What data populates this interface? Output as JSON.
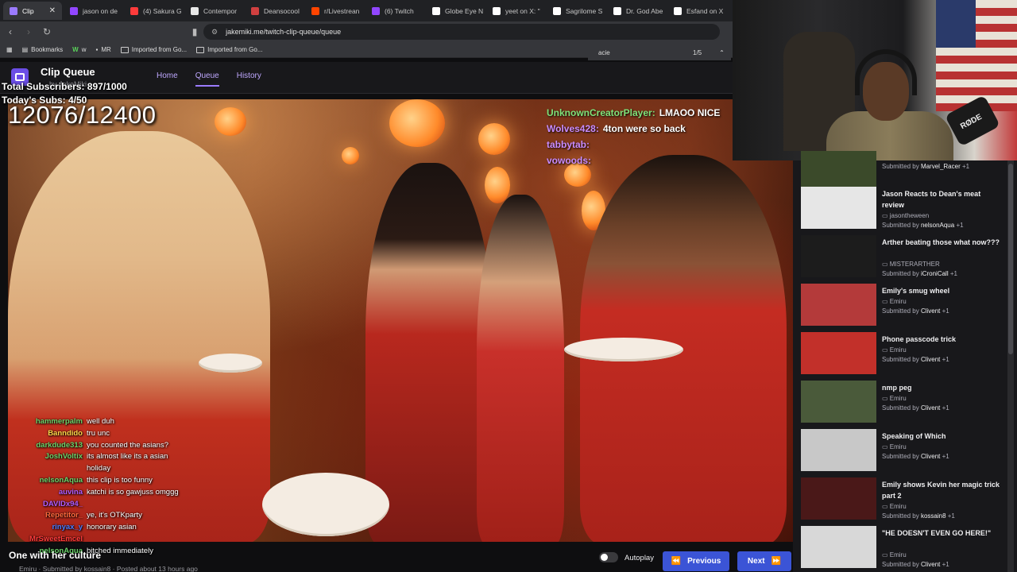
{
  "browser": {
    "tabs": [
      {
        "label": "Clip",
        "color": "#9b7bff",
        "active": true
      },
      {
        "label": "jason on de",
        "color": "#9146ff"
      },
      {
        "label": "(4) Sakura G",
        "color": "#ff3b3b"
      },
      {
        "label": "Contempor",
        "color": "#e8e8e8"
      },
      {
        "label": "Deansocool",
        "color": "#d04040"
      },
      {
        "label": "r/Livestrean",
        "color": "#ff4500"
      },
      {
        "label": "(6) Twitch",
        "color": "#9146ff"
      },
      {
        "label": "Globe Eye N",
        "color": "#ffffff"
      },
      {
        "label": "yeet on X: \"",
        "color": "#ffffff"
      },
      {
        "label": "Sagrilome S",
        "color": "#ffffff"
      },
      {
        "label": "Dr. God Abe",
        "color": "#ffffff"
      },
      {
        "label": "Esfand on X",
        "color": "#ffffff"
      }
    ],
    "tab_close": "✕",
    "url": "jakemiki.me/twitch-clip-queue/queue",
    "bookmarks": [
      "Bookmarks",
      "w",
      "MR",
      "Imported from Go...",
      "Imported from Go..."
    ],
    "find": {
      "query": "acie",
      "count": "1/5"
    }
  },
  "app": {
    "title": "Clip Queue",
    "subtitle": "by JakeMiki",
    "nav": [
      "Home",
      "Queue",
      "History"
    ]
  },
  "overlay": {
    "total_subs": "Total Subscribers: 897/1000",
    "todays_subs": "Today's Subs: 4/50",
    "counter": "12076/12400",
    "top_chat": [
      {
        "name": "UnknownCreatorPlayer:",
        "text": "LMAOO NICE",
        "color": "#7fe37a"
      },
      {
        "name": "Wolves428:",
        "text": "4ton were so back",
        "color": "#c98cff"
      },
      {
        "name": "tabbytab:",
        "text": "",
        "color": "#c98cff"
      },
      {
        "name": "vowoods:",
        "text": "",
        "color": "#c98cff"
      }
    ],
    "chat": [
      {
        "name": "hammerpalm",
        "text": "well duh",
        "color": "#6ad36a"
      },
      {
        "name": "Banndido",
        "text": "tru unc",
        "color": "#ffd84a"
      },
      {
        "name": "darkdude313",
        "text": "you counted the asians?",
        "color": "#6ad36a"
      },
      {
        "name": "JoshVoltix",
        "text": "its almost like its a asian",
        "color": "#6ad36a"
      },
      {
        "name": "",
        "text": "holiday",
        "color": "#6ad36a"
      },
      {
        "name": "nelsonAqua",
        "text": "this clip is too funny",
        "color": "#6ad36a"
      },
      {
        "name": "auvina",
        "text": "katchi is so gawjuss omggg",
        "color": "#b05cff"
      },
      {
        "name": "DAVIDx94_",
        "text": "",
        "color": "#b05cff"
      },
      {
        "name": "Repetitor_",
        "text": "ye, it's OTKparty",
        "color": "#ff6a3d"
      },
      {
        "name": "rinyax_y",
        "text": "honorary asian",
        "color": "#4a7cff"
      },
      {
        "name": "MrSweetEmcel",
        "text": "",
        "color": "#ff3b3b"
      },
      {
        "name": "nelsonAqua",
        "text": "bitched immediately",
        "color": "#6ad36a"
      }
    ]
  },
  "clip": {
    "title": "One with her culture",
    "meta": "Emiru · Submitted by kossain8 · Posted about 13 hours ago"
  },
  "controls": {
    "autoplay": "Autoplay",
    "previous": "Previous",
    "next": "Next",
    "previous_icon": "⏪",
    "next_icon": "⏩"
  },
  "webcam": {
    "mic_brand": "RØDE"
  },
  "queue": [
    {
      "title": "",
      "channel": "",
      "submitted": "Submitted by",
      "by": "Marvel_Racer",
      "plus": "+1",
      "thumb": "#3b4a2a"
    },
    {
      "title": "Jason Reacts to Dean's meat review",
      "channel": "jasontheween",
      "submitted": "Submitted by",
      "by": "nelsonAqua",
      "plus": "+1",
      "thumb": "#e6e6e6"
    },
    {
      "title": "Arther beating those what now???",
      "channel": "MISTERARTHER",
      "submitted": "Submitted by",
      "by": "iCroniCall",
      "plus": "+1",
      "thumb": "#1c1c1c"
    },
    {
      "title": "Emily's smug wheel",
      "channel": "Emiru",
      "submitted": "Submitted by",
      "by": "Clivent",
      "plus": "+1",
      "thumb": "#b43a3a"
    },
    {
      "title": "Phone passcode trick",
      "channel": "Emiru",
      "submitted": "Submitted by",
      "by": "Clivent",
      "plus": "+1",
      "thumb": "#c2302a"
    },
    {
      "title": "nmp peg",
      "channel": "Emiru",
      "submitted": "Submitted by",
      "by": "Clivent",
      "plus": "+1",
      "thumb": "#4a5a3a"
    },
    {
      "title": "Speaking of Which",
      "channel": "Emiru",
      "submitted": "Submitted by",
      "by": "Clivent",
      "plus": "+1",
      "thumb": "#c8c8c8"
    },
    {
      "title": "Emily shows Kevin her magic trick part 2",
      "channel": "Emiru",
      "submitted": "Submitted by",
      "by": "kossain8",
      "plus": "+1",
      "thumb": "#4a1818"
    },
    {
      "title": "\"HE DOESN'T EVEN GO HERE!\"",
      "channel": "Emiru",
      "submitted": "Submitted by",
      "by": "Clivent",
      "plus": "+1",
      "thumb": "#d8d8d8"
    }
  ]
}
